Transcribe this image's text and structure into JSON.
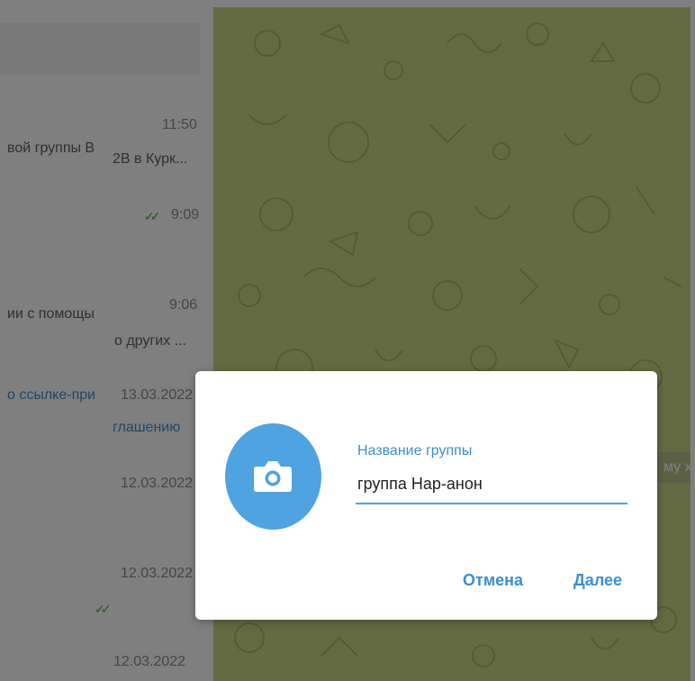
{
  "chat_list": [
    {
      "time": "11:50",
      "preview_line1": "вой группы В",
      "preview_line2": "2В в Курк..."
    },
    {
      "time": "9:09",
      "ticks": "✓✓"
    },
    {
      "time": "9:06",
      "preview_line1": "ии с помощы",
      "preview_line2": "о других ..."
    },
    {
      "time": "13.03.2022",
      "preview_link1": "о ссылке-при",
      "preview_link2": "глашению"
    },
    {
      "time": "12.03.2022"
    },
    {
      "time": "12.03.2022",
      "ticks": "✓✓"
    },
    {
      "time": "12.03.2022"
    }
  ],
  "chat_area": {
    "side_bubble": "му хо"
  },
  "dialog": {
    "field_label": "Название группы",
    "group_name_value": "группа Нар-анон",
    "cancel_label": "Отмена",
    "next_label": "Далее"
  },
  "icons": {
    "avatar": "camera-icon"
  },
  "colors": {
    "accent": "#4fa3e0",
    "link": "#3a8fd1",
    "chat_background": "#c9d687"
  }
}
